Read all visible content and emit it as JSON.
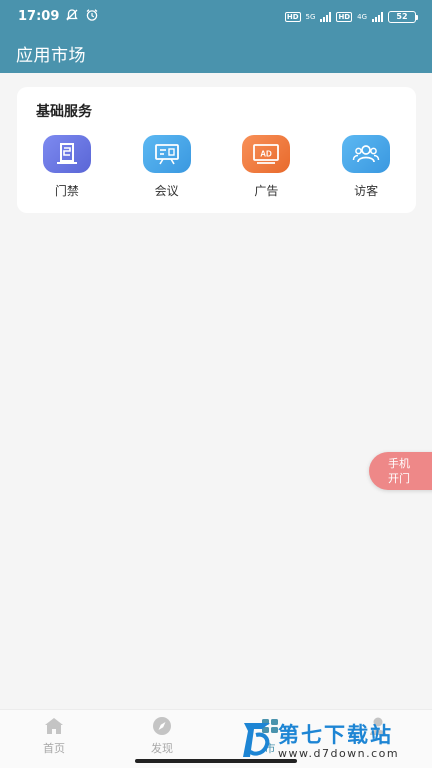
{
  "status_bar": {
    "time": "17:09",
    "hd1": "HD",
    "net1": "5G",
    "hd2": "HD",
    "net2": "4G",
    "battery": "52"
  },
  "header": {
    "title": "应用市场"
  },
  "basic_services": {
    "title": "基础服务",
    "items": [
      {
        "label": "门禁",
        "icon": "door-access-icon",
        "color": "#6d7ae0"
      },
      {
        "label": "会议",
        "icon": "meeting-icon",
        "color": "#4aa8e8"
      },
      {
        "label": "广告",
        "icon": "ad-icon",
        "color": "#f07a3e"
      },
      {
        "label": "访客",
        "icon": "visitor-icon",
        "color": "#4aa8e8"
      }
    ]
  },
  "float_button": {
    "line1": "手机",
    "line2": "开门"
  },
  "tabbar": {
    "items": [
      {
        "label": "首页",
        "icon": "home-icon"
      },
      {
        "label": "发现",
        "icon": "compass-icon"
      },
      {
        "label": "市",
        "icon": "market-icon"
      },
      {
        "label": "",
        "icon": "profile-icon"
      }
    ]
  },
  "watermark": {
    "title": "第七下载站",
    "url": "www.d7down.com"
  },
  "colors": {
    "primary": "#4a93ad",
    "float": "#ee8888"
  }
}
